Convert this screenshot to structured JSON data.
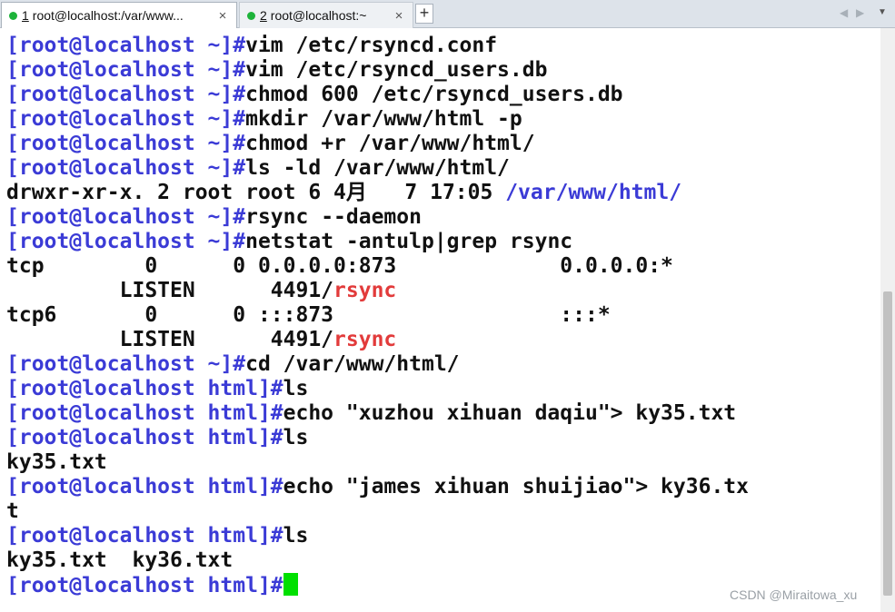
{
  "tabs": [
    {
      "number": "1",
      "title": "root@localhost:/var/www...",
      "close": "×"
    },
    {
      "number": "2",
      "title": "root@localhost:~",
      "close": "×"
    }
  ],
  "tabbar": {
    "new_tab": "+",
    "prev": "◀",
    "next": "▶",
    "menu": "▼"
  },
  "terminal": {
    "lines": [
      {
        "prompt": "[root@localhost ~]#",
        "cmd": "vim /etc/rsyncd.conf"
      },
      {
        "prompt": "[root@localhost ~]#",
        "cmd": "vim /etc/rsyncd_users.db"
      },
      {
        "prompt": "[root@localhost ~]#",
        "cmd": "chmod 600 /etc/rsyncd_users.db"
      },
      {
        "prompt": "[root@localhost ~]#",
        "cmd": "mkdir /var/www/html -p"
      },
      {
        "prompt": "[root@localhost ~]#",
        "cmd": "chmod +r /var/www/html/"
      },
      {
        "prompt": "[root@localhost ~]#",
        "cmd": "ls -ld /var/www/html/"
      },
      {
        "out": "drwxr-xr-x. 2 root root 6 4月   7 17:05 ",
        "blue": "/var/www/html/"
      },
      {
        "prompt": "[root@localhost ~]#",
        "cmd": "rsync --daemon"
      },
      {
        "prompt": "[root@localhost ~]#",
        "cmd": "netstat -antulp|grep rsync"
      },
      {
        "out": "tcp        0      0 0.0.0.0:873             0.0.0.0:*"
      },
      {
        "out": "         LISTEN      4491/",
        "red": "rsync"
      },
      {
        "out": "tcp6       0      0 :::873                  :::*"
      },
      {
        "out": "         LISTEN      4491/",
        "red": "rsync"
      },
      {
        "prompt": "[root@localhost ~]#",
        "cmd": "cd /var/www/html/"
      },
      {
        "prompt": "[root@localhost html]#",
        "cmd": "ls"
      },
      {
        "prompt": "[root@localhost html]#",
        "cmd": "echo \"xuzhou xihuan daqiu\"> ky35.txt"
      },
      {
        "prompt": "[root@localhost html]#",
        "cmd": "ls"
      },
      {
        "out": "ky35.txt"
      },
      {
        "prompt": "[root@localhost html]#",
        "cmd": "echo \"james xihuan shuijiao\"> ky36.tx"
      },
      {
        "out": "t"
      },
      {
        "prompt": "[root@localhost html]#",
        "cmd": "ls"
      },
      {
        "out": "ky35.txt  ky36.txt"
      },
      {
        "prompt": "[root@localhost html]#",
        "cmd": "",
        "cursor": true
      }
    ]
  },
  "watermark": "CSDN @Miraitowa_xu",
  "colors": {
    "prompt": "#3b3bd6",
    "highlight": "#e23b3b",
    "cursor": "#00e000",
    "tab_dot": "#1db33a"
  }
}
